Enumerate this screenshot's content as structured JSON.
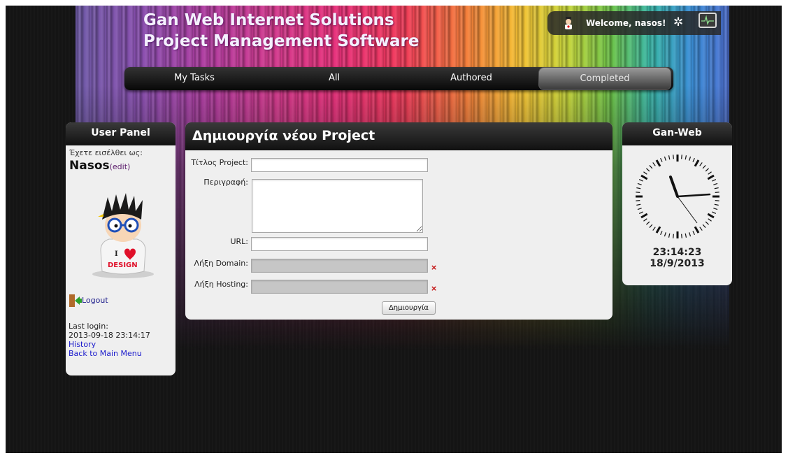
{
  "header": {
    "title_line1": "Gan Web Internet Solutions",
    "title_line2": "Project Management Software",
    "welcome_text": "Welcome, nasos!",
    "gear_icon": "gear-icon",
    "monitor_icon": "activity-monitor-icon"
  },
  "nav": {
    "tabs": [
      {
        "label": "My Tasks",
        "active": false
      },
      {
        "label": "All",
        "active": false
      },
      {
        "label": "Authored",
        "active": false
      },
      {
        "label": "Completed",
        "active": true
      }
    ]
  },
  "user_panel": {
    "title": "User Panel",
    "logged_as": "Έχετε εισέλθει ως:",
    "username": "Nasos",
    "edit_label": "(edit)",
    "logout_label": "Logout",
    "last_login_label": "Last login:",
    "last_login_value": "2013-09-18 23:14:17",
    "history_link": "History",
    "back_link": "Back to Main Menu"
  },
  "form": {
    "title": "Δημιουργία νέου Project",
    "fields": {
      "title_label": "Τίτλος Project:",
      "title_value": "",
      "description_label": "Περιγραφή:",
      "description_value": "",
      "url_label": "URL:",
      "url_value": "",
      "domain_label": "Λήξη Domain:",
      "domain_value": "",
      "hosting_label": "Λήξη Hosting:",
      "hosting_value": ""
    },
    "clear_mark": "×",
    "submit_label": "Δημιουργία"
  },
  "clock_panel": {
    "title": "Gan-Web",
    "time": "23:14:23",
    "date": "18/9/2013"
  },
  "colors": {
    "panel_bg": "#efefef",
    "header_dark": "#111111",
    "link_blue": "#1a1acc",
    "error_red": "#c00000"
  }
}
